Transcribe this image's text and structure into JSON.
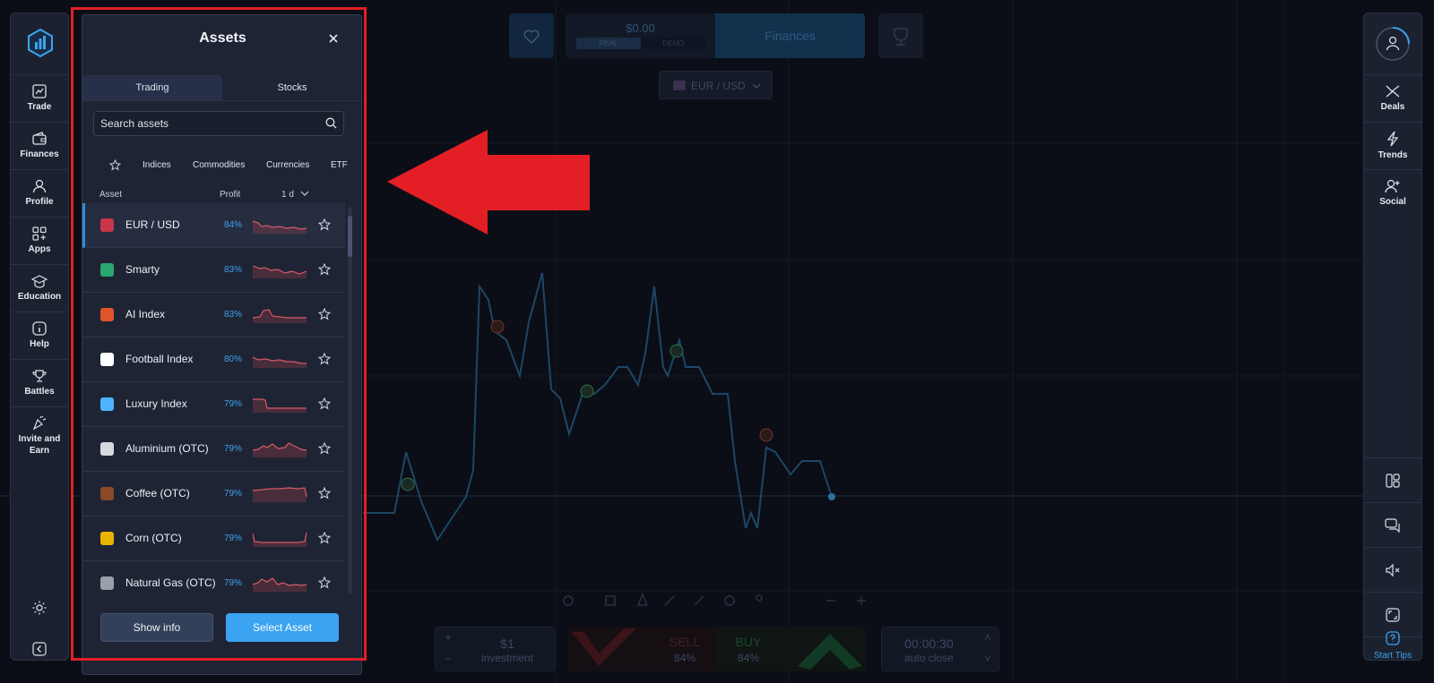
{
  "left_sidebar": {
    "items": [
      {
        "label": "Trade",
        "icon": "chart-line-icon"
      },
      {
        "label": "Finances",
        "icon": "wallet-icon"
      },
      {
        "label": "Profile",
        "icon": "user-icon"
      },
      {
        "label": "Apps",
        "icon": "apps-grid-icon"
      },
      {
        "label": "Education",
        "icon": "graduation-cap-icon"
      },
      {
        "label": "Help",
        "icon": "info-icon"
      },
      {
        "label": "Battles",
        "icon": "trophy-icon"
      },
      {
        "label": "Invite and Earn",
        "icon": "party-popper-icon"
      }
    ]
  },
  "right_sidebar": {
    "items": [
      {
        "label": "Deals",
        "icon": "deals-icon"
      },
      {
        "label": "Trends",
        "icon": "lightning-icon"
      },
      {
        "label": "Social",
        "icon": "user-plus-icon"
      }
    ],
    "start_tips": "Start Tips"
  },
  "top_bar": {
    "balance": "$0.00",
    "real_label": "REAL",
    "demo_label": "DEMO",
    "finances_label": "Finances",
    "pair": "EUR / USD"
  },
  "assets_panel": {
    "title": "Assets",
    "tabs": [
      "Trading",
      "Stocks"
    ],
    "search_placeholder": "Search assets",
    "categories": [
      "Indices",
      "Commodities",
      "Currencies",
      "ETF"
    ],
    "columns": {
      "asset": "Asset",
      "profit": "Profit",
      "period": "1 d"
    },
    "assets": [
      {
        "name": "EUR / USD",
        "profit": "84%",
        "selected": true,
        "icon_color": "#c9364a"
      },
      {
        "name": "Smarty",
        "profit": "83%",
        "selected": false,
        "icon_color": "#2aa86e"
      },
      {
        "name": "AI Index",
        "profit": "83%",
        "selected": false,
        "icon_color": "#e0542a"
      },
      {
        "name": "Football Index",
        "profit": "80%",
        "selected": false,
        "icon_color": "#ffffff"
      },
      {
        "name": "Luxury Index",
        "profit": "79%",
        "selected": false,
        "icon_color": "#4fb3ff"
      },
      {
        "name": "Aluminium (OTC)",
        "profit": "79%",
        "selected": false,
        "icon_color": "#d6d9de"
      },
      {
        "name": "Coffee (OTC)",
        "profit": "79%",
        "selected": false,
        "icon_color": "#8a4a2a"
      },
      {
        "name": "Corn (OTC)",
        "profit": "79%",
        "selected": false,
        "icon_color": "#e8b400"
      },
      {
        "name": "Natural Gas (OTC)",
        "profit": "79%",
        "selected": false,
        "icon_color": "#9aa0aa"
      }
    ],
    "show_info_label": "Show info",
    "select_asset_label": "Select Asset"
  },
  "bottom_bar": {
    "investment_value": "$1",
    "investment_label": "investment",
    "sell_label": "SELL",
    "sell_pct": "84%",
    "buy_label": "BUY",
    "buy_pct": "84%",
    "timer_value": "00:00:30",
    "timer_label": "auto close"
  },
  "colors": {
    "accent": "#3aa4f2",
    "annotation_red": "#e41e25",
    "panel_bg": "#1f2434",
    "profit_blue": "#3ca3f0"
  }
}
